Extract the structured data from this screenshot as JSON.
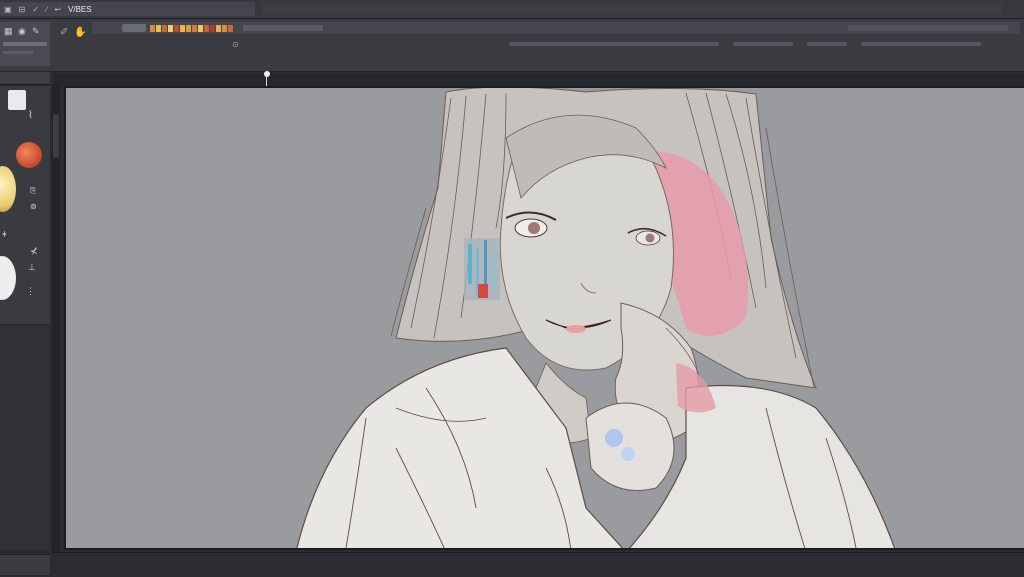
{
  "menubar": {
    "items": [
      "▣",
      "⊟",
      "✓",
      "∕",
      "↩",
      "V/BES"
    ]
  },
  "toolbar": {
    "icons": [
      "grid-icon",
      "eye-icon",
      "brush-icon",
      "pen-icon"
    ]
  },
  "icons": {
    "menu": "grid-icon",
    "brush": "brush-icon",
    "pen": "pen-icon",
    "eyedropper": "eyedropper-icon",
    "hand": "hand-icon"
  },
  "colors": {
    "accent_orange": "#e0683c",
    "accent_yellow": "#f3e3a2",
    "canvas_bg": "#9a9b9e",
    "hair_pink": "#e88aa0"
  }
}
